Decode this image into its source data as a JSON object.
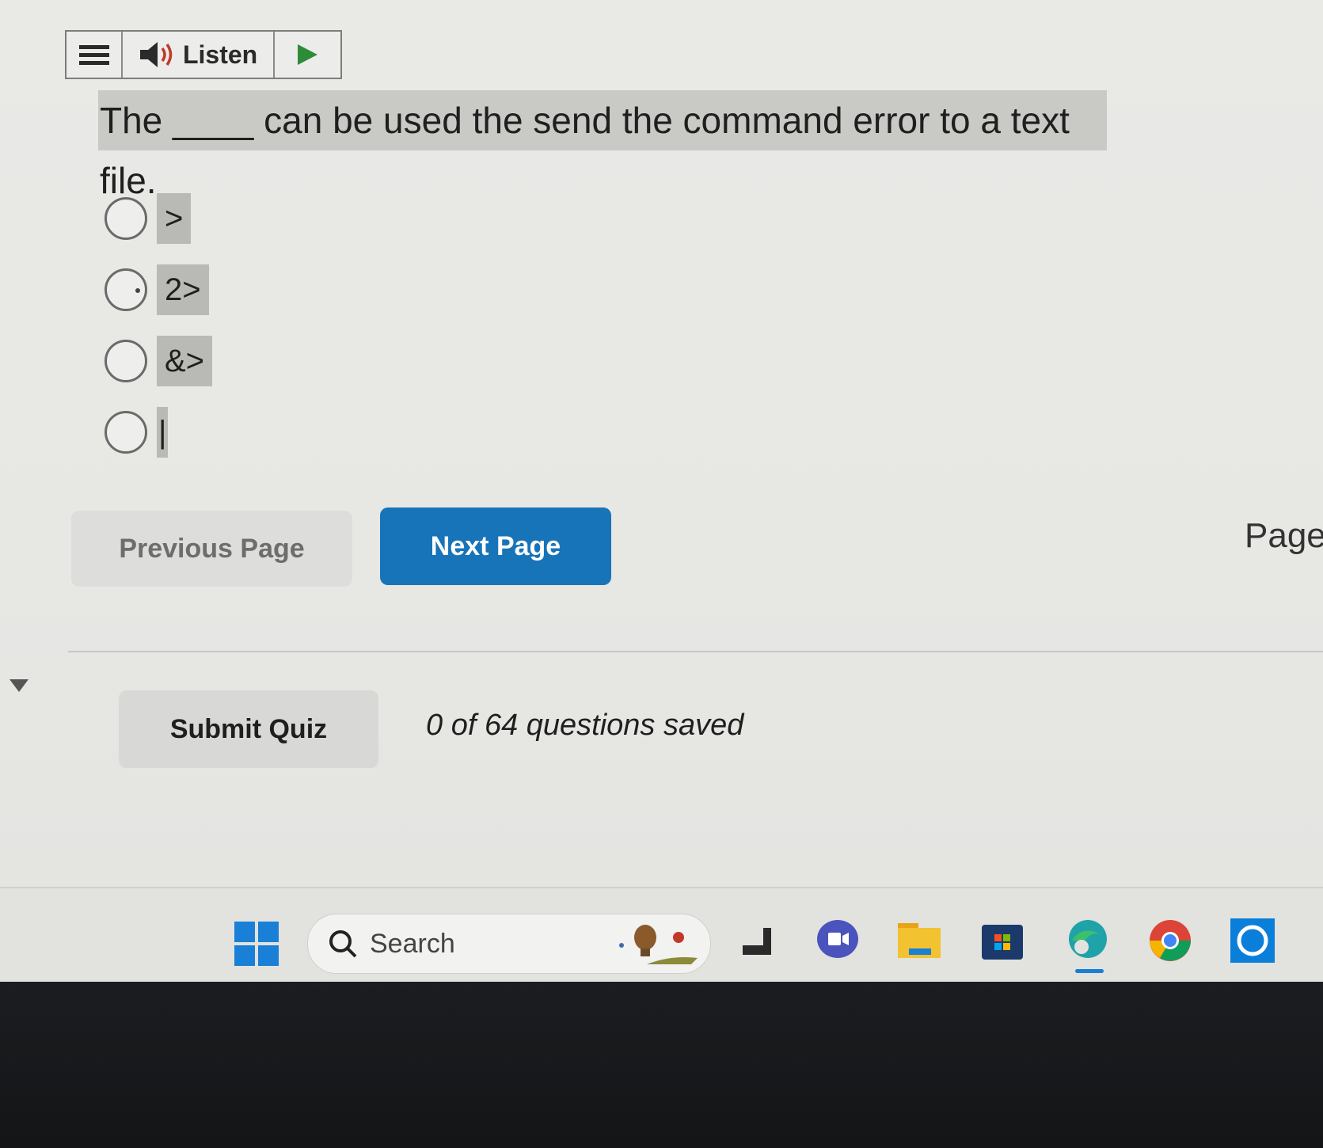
{
  "toolbar": {
    "listen_label": "Listen"
  },
  "question": {
    "text": "The ____ can be used the send the command error to a text file."
  },
  "options": [
    {
      "label": ">"
    },
    {
      "label": "2>"
    },
    {
      "label": "&>"
    },
    {
      "label": "|"
    }
  ],
  "navigation": {
    "previous_label": "Previous Page",
    "next_label": "Next Page",
    "page_label": "Page"
  },
  "footer": {
    "submit_label": "Submit Quiz",
    "saved_status": "0 of 64 questions saved"
  },
  "taskbar": {
    "search_label": "Search",
    "icons": [
      "windows-start-icon",
      "search-icon",
      "widgets-icon",
      "task-view-icon",
      "teams-chat-icon",
      "file-explorer-icon",
      "microsoft-store-icon",
      "edge-icon",
      "chrome-icon",
      "cortana-icon"
    ]
  },
  "colors": {
    "accent": "#1874b8",
    "highlight": "#c9c9c6",
    "windows_blue": "#1a7fd6"
  }
}
